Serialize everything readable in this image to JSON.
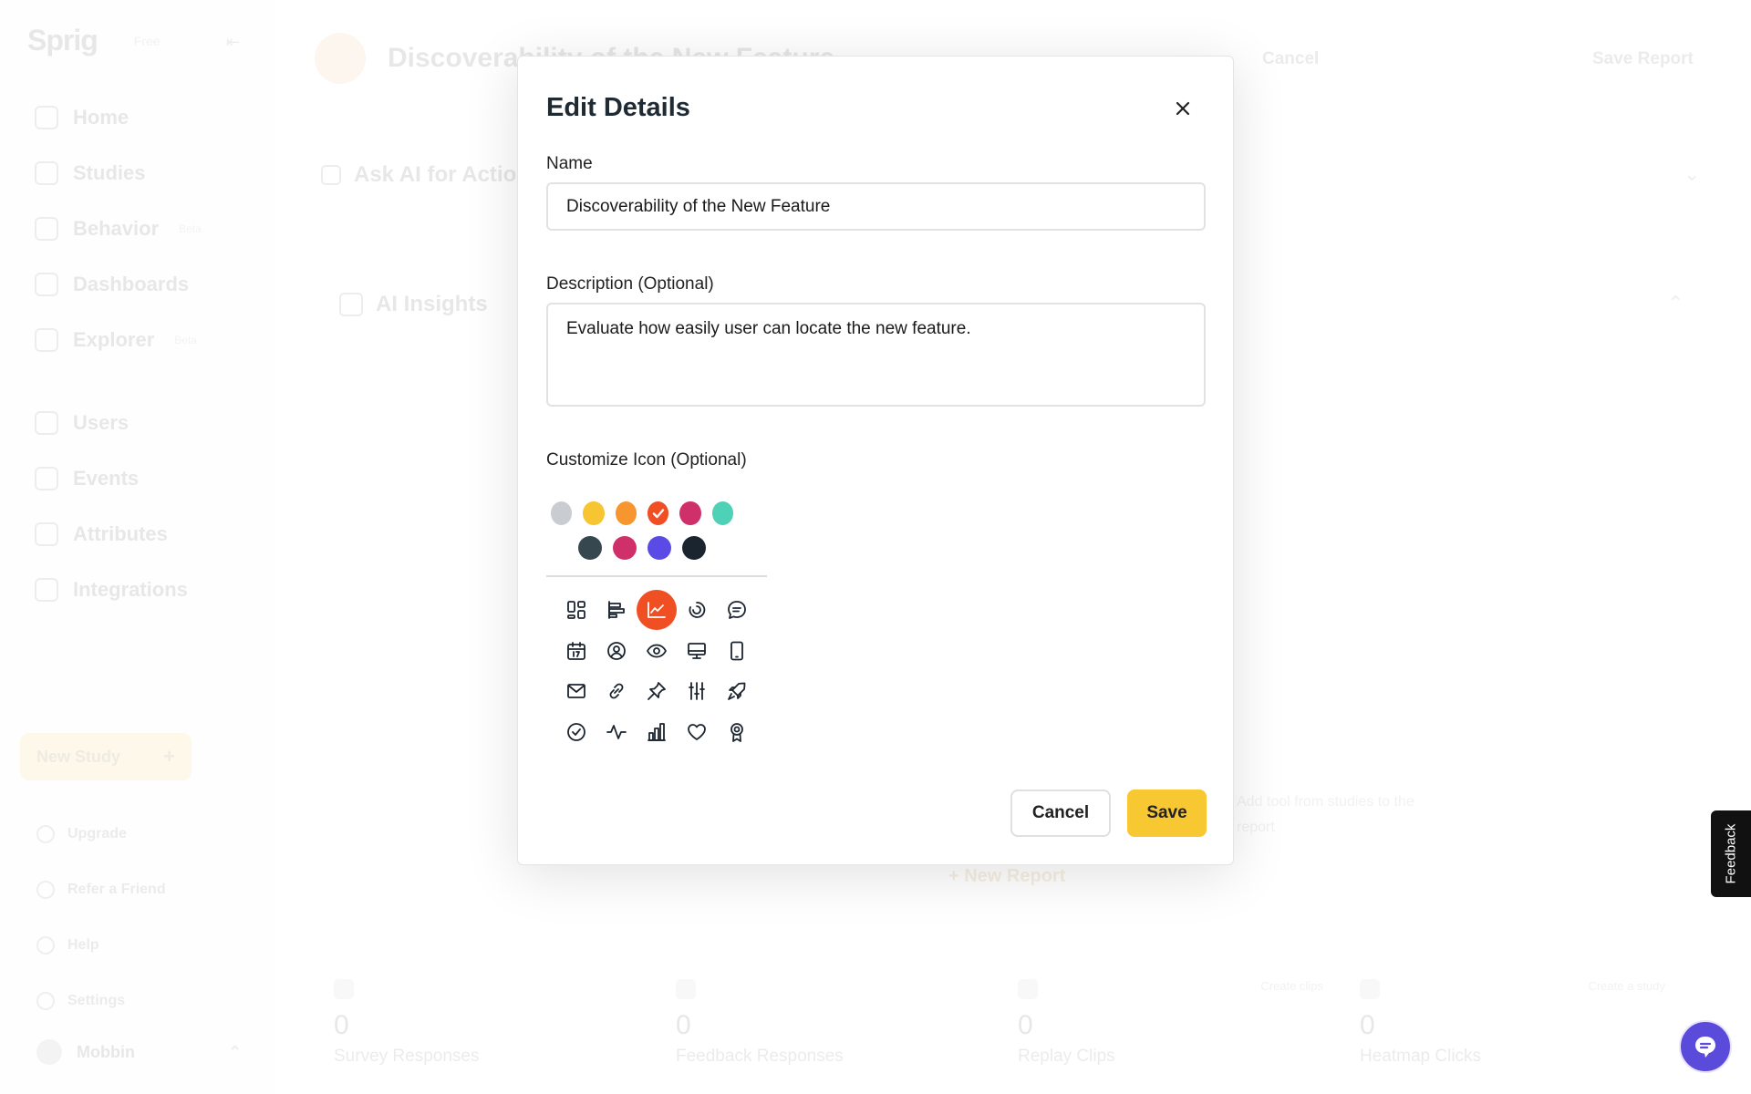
{
  "background": {
    "logo": "Sprig",
    "plan": "Free",
    "nav": [
      {
        "label": "Home",
        "tag": ""
      },
      {
        "label": "Studies",
        "tag": ""
      },
      {
        "label": "Behavior",
        "tag": "Beta"
      },
      {
        "label": "Dashboards",
        "tag": ""
      },
      {
        "label": "Explorer",
        "tag": "Beta"
      }
    ],
    "nav2": [
      {
        "label": "Users"
      },
      {
        "label": "Events"
      },
      {
        "label": "Attributes"
      },
      {
        "label": "Integrations"
      }
    ],
    "new_study": "New Study",
    "bottom": [
      {
        "label": "Upgrade"
      },
      {
        "label": "Refer a Friend"
      },
      {
        "label": "Help"
      },
      {
        "label": "Settings"
      }
    ],
    "user": "Mobbin",
    "page_title": "Discoverability of the New Feature",
    "top_cancel": "Cancel",
    "top_save": "Save Report",
    "ask_ai": "Ask AI for Actionable Insights",
    "ai_insights": "AI Insights",
    "hint": "Add tool from studies to the report",
    "new_report": "+ New Report",
    "stats": [
      {
        "value": "0",
        "label": "Survey Responses",
        "side": ""
      },
      {
        "value": "0",
        "label": "Feedback Responses",
        "side": ""
      },
      {
        "value": "0",
        "label": "Replay Clips",
        "side": "Create clips"
      },
      {
        "value": "0",
        "label": "Heatmap Clicks",
        "side": "Create a study"
      }
    ]
  },
  "modal": {
    "title": "Edit Details",
    "name_label": "Name",
    "name_value": "Discoverability of the New Feature",
    "desc_label": "Description (Optional)",
    "desc_value": "Evaluate how easily user can locate the new feature.",
    "icon_label": "Customize Icon (Optional)",
    "colors_row1": [
      "#c9cdd1",
      "#f7c531",
      "#f7962f",
      "#f04e23",
      "#d0306a",
      "#4fd1b8"
    ],
    "colors_row2": [
      "#37474f",
      "#d0306a",
      "#5b4be6",
      "#1b2530"
    ],
    "selected_color": "#f04e23",
    "icons": [
      "dashboard-icon",
      "chart-bars-horizontal-icon",
      "line-chart-icon",
      "loading-circle-icon",
      "chat-bubble-icon",
      "calendar-icon",
      "user-circle-icon",
      "eye-icon",
      "monitor-icon",
      "mobile-icon",
      "mail-icon",
      "link-icon",
      "pin-icon",
      "sliders-icon",
      "rocket-icon",
      "check-circle-icon",
      "activity-icon",
      "bar-chart-icon",
      "heart-icon",
      "award-icon"
    ],
    "selected_icon": "line-chart-icon",
    "cancel_label": "Cancel",
    "save_label": "Save"
  },
  "floating": {
    "feedback_label": "Feedback"
  }
}
